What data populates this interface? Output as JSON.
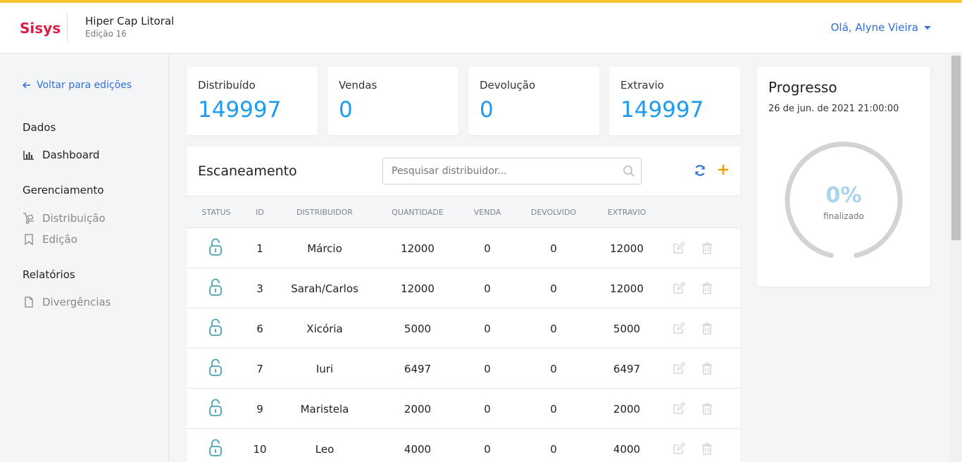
{
  "header": {
    "brand": "Sisys",
    "title": "Hiper Cap Litoral",
    "subtitle": "Edição 16",
    "user_greeting": "Olá, Alyne Vieira"
  },
  "sidebar": {
    "back_label": "Voltar para edições",
    "sections": [
      {
        "title": "Dados",
        "items": [
          {
            "label": "Dashboard",
            "icon": "bar-chart-icon"
          }
        ]
      },
      {
        "title": "Gerenciamento",
        "items": [
          {
            "label": "Distribuição",
            "icon": "dolly-icon"
          },
          {
            "label": "Edição",
            "icon": "bookmark-icon"
          }
        ]
      },
      {
        "title": "Relatórios",
        "items": [
          {
            "label": "Divergências",
            "icon": "file-icon"
          }
        ]
      }
    ]
  },
  "stats": [
    {
      "label": "Distribuído",
      "value": "149997"
    },
    {
      "label": "Vendas",
      "value": "0"
    },
    {
      "label": "Devolução",
      "value": "0"
    },
    {
      "label": "Extravio",
      "value": "149997"
    }
  ],
  "scan": {
    "title": "Escaneamento",
    "search_placeholder": "Pesquisar distribuidor...",
    "columns": [
      "STATUS",
      "ID",
      "DISTRIBUIDOR",
      "QUANTIDADE",
      "VENDA",
      "DEVOLVIDO",
      "EXTRAVIO"
    ],
    "rows": [
      {
        "id": "1",
        "name": "Márcio",
        "qty": "12000",
        "venda": "0",
        "devolvido": "0",
        "extravio": "12000"
      },
      {
        "id": "3",
        "name": "Sarah/Carlos",
        "qty": "12000",
        "venda": "0",
        "devolvido": "0",
        "extravio": "12000"
      },
      {
        "id": "6",
        "name": "Xicória",
        "qty": "5000",
        "venda": "0",
        "devolvido": "0",
        "extravio": "5000"
      },
      {
        "id": "7",
        "name": "Iuri",
        "qty": "6497",
        "venda": "0",
        "devolvido": "0",
        "extravio": "6497"
      },
      {
        "id": "9",
        "name": "Maristela",
        "qty": "2000",
        "venda": "0",
        "devolvido": "0",
        "extravio": "2000"
      },
      {
        "id": "10",
        "name": "Leo",
        "qty": "4000",
        "venda": "0",
        "devolvido": "0",
        "extravio": "4000"
      }
    ]
  },
  "progress": {
    "title": "Progresso",
    "date": "26 de jun. de 2021 21:00:00",
    "percent_label": "0%",
    "sub_label": "finalizado",
    "value": 0
  },
  "colors": {
    "accent_bar": "#f7c532",
    "brand": "#d61f45",
    "link": "#2f6fd6",
    "stat_value": "#1d9bf0",
    "lock_icon": "#4aa3b5",
    "add_icon": "#f39c12"
  }
}
